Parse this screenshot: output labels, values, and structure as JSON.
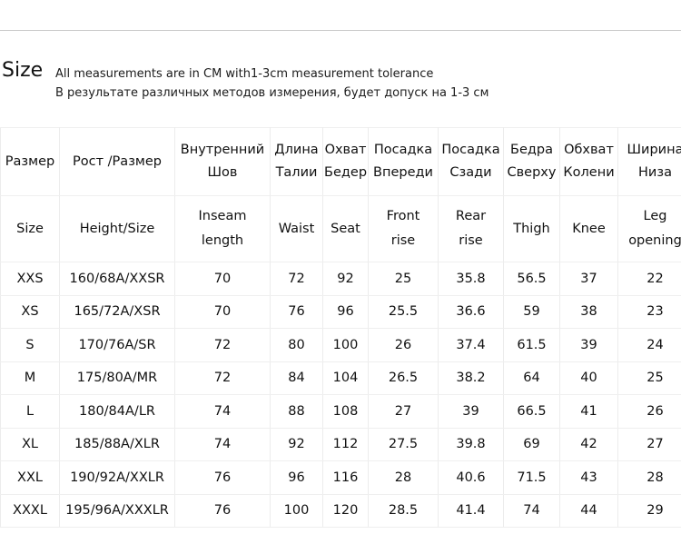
{
  "header": {
    "title": "Size",
    "note_en": "All measurements are in CM with1-3cm measurement tolerance",
    "note_ru": "В результате различных методов измерения, будет допуск на 1-3 см"
  },
  "table": {
    "headers_ru_line1": [
      "Размер",
      "Рост /Размер",
      "Внутренний",
      "Длина",
      "Охват",
      "Посадка",
      "Посадка",
      "Бедра",
      "Обхват",
      "Ширина"
    ],
    "headers_ru_line2": [
      "",
      "",
      "Шов",
      "Талии",
      "Бедер",
      "Впереди",
      "Сзади",
      "Сверху",
      "Колени",
      "Низа"
    ],
    "headers_en_line1": [
      "Size",
      "Height/Size",
      "Inseam",
      "Waist",
      "Seat",
      "Front",
      "Rear",
      "Thigh",
      "Knee",
      "Leg"
    ],
    "headers_en_line2": [
      "",
      "",
      "length",
      "",
      "",
      "rise",
      "rise",
      "",
      "",
      "opening"
    ],
    "rows": [
      {
        "size": "XXS",
        "height": "160/68A/XXSR",
        "inseam": "70",
        "waist": "72",
        "seat": "92",
        "front_rise": "25",
        "rear_rise": "35.8",
        "thigh": "56.5",
        "knee": "37",
        "leg_opening": "22"
      },
      {
        "size": "XS",
        "height": "165/72A/XSR",
        "inseam": "70",
        "waist": "76",
        "seat": "96",
        "front_rise": "25.5",
        "rear_rise": "36.6",
        "thigh": "59",
        "knee": "38",
        "leg_opening": "23"
      },
      {
        "size": "S",
        "height": "170/76A/SR",
        "inseam": "72",
        "waist": "80",
        "seat": "100",
        "front_rise": "26",
        "rear_rise": "37.4",
        "thigh": "61.5",
        "knee": "39",
        "leg_opening": "24"
      },
      {
        "size": "M",
        "height": "175/80A/MR",
        "inseam": "72",
        "waist": "84",
        "seat": "104",
        "front_rise": "26.5",
        "rear_rise": "38.2",
        "thigh": "64",
        "knee": "40",
        "leg_opening": "25"
      },
      {
        "size": "L",
        "height": "180/84A/LR",
        "inseam": "74",
        "waist": "88",
        "seat": "108",
        "front_rise": "27",
        "rear_rise": "39",
        "thigh": "66.5",
        "knee": "41",
        "leg_opening": "26"
      },
      {
        "size": "XL",
        "height": "185/88A/XLR",
        "inseam": "74",
        "waist": "92",
        "seat": "112",
        "front_rise": "27.5",
        "rear_rise": "39.8",
        "thigh": "69",
        "knee": "42",
        "leg_opening": "27"
      },
      {
        "size": "XXL",
        "height": "190/92A/XXLR",
        "inseam": "76",
        "waist": "96",
        "seat": "116",
        "front_rise": "28",
        "rear_rise": "40.6",
        "thigh": "71.5",
        "knee": "43",
        "leg_opening": "28"
      },
      {
        "size": "XXXL",
        "height": "195/96A/XXXLR",
        "inseam": "76",
        "waist": "100",
        "seat": "120",
        "front_rise": "28.5",
        "rear_rise": "41.4",
        "thigh": "74",
        "knee": "44",
        "leg_opening": "29"
      }
    ]
  },
  "colors": {
    "background": "#ffffff",
    "text": "#111111",
    "border": "#efefef",
    "divider": "#c9c9c9"
  }
}
